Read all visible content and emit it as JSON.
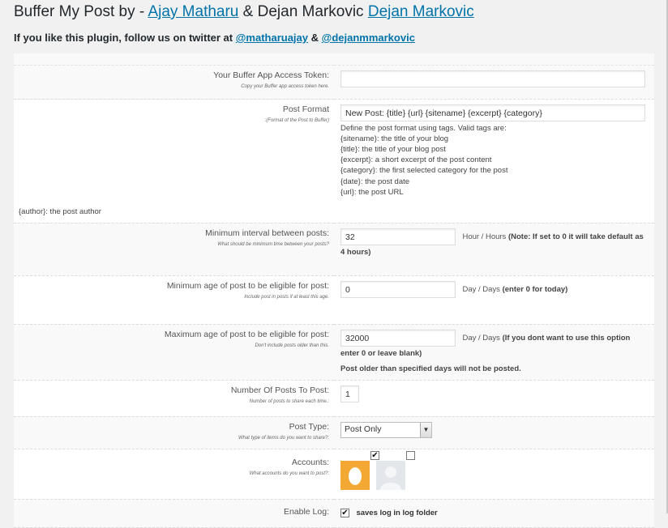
{
  "header": {
    "title_prefix": "Buffer My Post by - ",
    "author1_link": "Ajay Matharu",
    "title_mid": " & Dejan Markovic ",
    "author2_link": "Dejan Markovic",
    "follow_text": "If you like this plugin, follow us on twitter at ",
    "twitter1": "@matharuajay",
    "amp": " & ",
    "twitter2": "@dejanmmarkovic"
  },
  "fields": {
    "access_token": {
      "label": "Your Buffer App Access Token:",
      "hint": "Copy your Buffer app access token here.",
      "value": ""
    },
    "post_format": {
      "label": "Post Format",
      "hint": ":(Format of the Post to Buffer)",
      "value": "New Post: {title} {url} {sitename} {excerpt} {category}",
      "help_lines": [
        "Define the post format using tags. Valid tags are:",
        "{sitename}: the title of your blog",
        "{title}: the title of your blog post",
        "{excerpt}: a short excerpt of the post content",
        "{category}: the first selected category for the post",
        "{date}: the post date",
        "{url}: the post URL"
      ],
      "author_line": "{author}: the post author"
    },
    "min_interval": {
      "label": "Minimum interval between posts:",
      "hint": "What should be minimum time between your posts?",
      "value": "32",
      "unit": "Hour / Hours",
      "note": "(Note: If set to 0 it will take default as 4 hours)"
    },
    "min_age": {
      "label": "Minimum age of post to be eligible for post:",
      "hint": "Include post in posts if at least this age.",
      "value": "0",
      "unit": "Day / Days",
      "note": "(enter 0 for today)"
    },
    "max_age": {
      "label": "Maximum age of post to be eligible for post:",
      "hint": "Don't include posts older than this.",
      "value": "32000",
      "unit": "Day / Days",
      "note": "(If you dont want to use this option enter 0 or leave blank)",
      "extra": "Post older than specified days will not be posted."
    },
    "num_posts": {
      "label": "Number Of Posts To Post:",
      "hint": "Number of posts to share each time.:",
      "value": "1"
    },
    "post_type": {
      "label": "Post Type:",
      "hint": "What type of items do you want to share?:",
      "selected": "Post Only"
    },
    "accounts": {
      "label": "Accounts:",
      "hint": "What accounts do you want to post?:",
      "items": [
        {
          "checked": true,
          "checkmark": "✔",
          "avatar_color": "#f3a833"
        },
        {
          "checked": false,
          "checkmark": "",
          "avatar_color": "#e3e6ea"
        }
      ]
    },
    "enable_log": {
      "label": "Enable Log:",
      "checked": true,
      "checkmark": "✔",
      "text": "saves log in log folder"
    }
  },
  "colors": {
    "link": "#0073aa",
    "background": "#f1f1f1"
  }
}
